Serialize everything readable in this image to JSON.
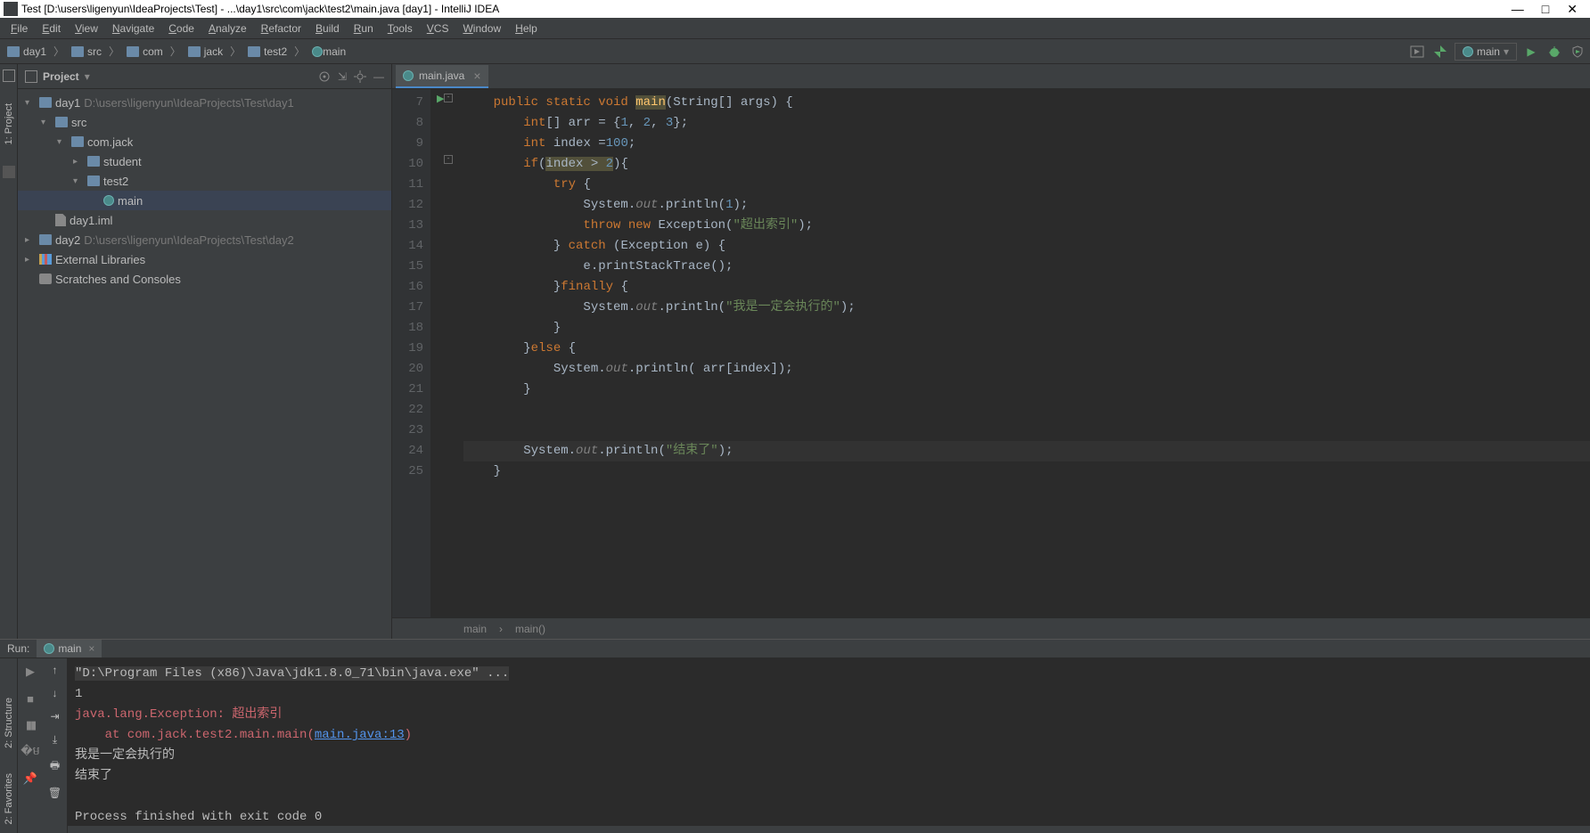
{
  "titlebar": {
    "text": "Test [D:\\users\\ligenyun\\IdeaProjects\\Test] - ...\\day1\\src\\com\\jack\\test2\\main.java [day1] - IntelliJ IDEA"
  },
  "menu": [
    "File",
    "Edit",
    "View",
    "Navigate",
    "Code",
    "Analyze",
    "Refactor",
    "Build",
    "Run",
    "Tools",
    "VCS",
    "Window",
    "Help"
  ],
  "breadcrumbs": [
    {
      "name": "day1",
      "icon": "module"
    },
    {
      "name": "src",
      "icon": "folder"
    },
    {
      "name": "com",
      "icon": "folder"
    },
    {
      "name": "jack",
      "icon": "folder"
    },
    {
      "name": "test2",
      "icon": "folder"
    },
    {
      "name": "main",
      "icon": "class"
    }
  ],
  "run_config_selected": "main",
  "project_panel": {
    "title": "Project",
    "tree": [
      {
        "depth": 0,
        "arrow": "down",
        "icon": "module",
        "label": "day1",
        "hint": "D:\\users\\ligenyun\\IdeaProjects\\Test\\day1"
      },
      {
        "depth": 1,
        "arrow": "down",
        "icon": "folder",
        "label": "src"
      },
      {
        "depth": 2,
        "arrow": "down",
        "icon": "folder",
        "label": "com.jack"
      },
      {
        "depth": 3,
        "arrow": "right",
        "icon": "folder",
        "label": "student"
      },
      {
        "depth": 3,
        "arrow": "down",
        "icon": "folder",
        "label": "test2"
      },
      {
        "depth": 4,
        "arrow": "",
        "icon": "class",
        "label": "main",
        "selected": true
      },
      {
        "depth": 1,
        "arrow": "",
        "icon": "file",
        "label": "day1.iml"
      },
      {
        "depth": 0,
        "arrow": "right",
        "icon": "module",
        "label": "day2",
        "hint": "D:\\users\\ligenyun\\IdeaProjects\\Test\\day2"
      },
      {
        "depth": 0,
        "arrow": "right",
        "icon": "lib",
        "label": "External Libraries"
      },
      {
        "depth": 0,
        "arrow": "",
        "icon": "scratch",
        "label": "Scratches and Consoles"
      }
    ]
  },
  "editor": {
    "tab_label": "main.java",
    "line_start": 7,
    "line_end": 25,
    "code_lines": [
      {
        "n": 7,
        "html": "    <span class='kw'>public static void</span> <span class='fn warn-bg'>main</span><span class='pln'>(String[] args) {</span>"
      },
      {
        "n": 8,
        "html": "        <span class='kw'>int</span><span class='pln'>[] arr = {</span><span class='num'>1</span><span class='pln'>, </span><span class='num'>2</span><span class='pln'>, </span><span class='num'>3</span><span class='pln'>};</span>"
      },
      {
        "n": 9,
        "html": "        <span class='kw'>int</span><span class='pln'> index =</span><span class='num'>100</span><span class='pln'>;</span>"
      },
      {
        "n": 10,
        "html": "        <span class='kw'>if</span><span class='pln'>(</span><span class='warn-bg'><span class='pln'>index &gt; </span><span class='num'>2</span></span><span class='pln'>){</span>"
      },
      {
        "n": 11,
        "html": "            <span class='kw'>try</span><span class='pln'> {</span>"
      },
      {
        "n": 12,
        "html": "                <span class='pln'>System.</span><span class='it'>out</span><span class='pln'>.println(</span><span class='num'>1</span><span class='pln'>);</span>"
      },
      {
        "n": 13,
        "html": "                <span class='kw'>throw new</span><span class='pln'> Exception(</span><span class='str'>\"超出索引\"</span><span class='pln'>);</span>"
      },
      {
        "n": 14,
        "html": "            <span class='pln'>} </span><span class='kw'>catch</span><span class='pln'> (Exception e) {</span>"
      },
      {
        "n": 15,
        "html": "                <span class='pln'>e.printStackTrace();</span>"
      },
      {
        "n": 16,
        "html": "            <span class='pln'>}</span><span class='kw'>finally</span><span class='pln'> {</span>"
      },
      {
        "n": 17,
        "html": "                <span class='pln'>System.</span><span class='it'>out</span><span class='pln'>.println(</span><span class='str'>\"我是一定会执行的\"</span><span class='pln'>);</span>"
      },
      {
        "n": 18,
        "html": "            <span class='pln'>}</span>"
      },
      {
        "n": 19,
        "html": "        <span class='pln'>}</span><span class='kw'>else</span><span class='pln'> {</span>"
      },
      {
        "n": 20,
        "html": "            <span class='pln'>System.</span><span class='it'>out</span><span class='pln'>.println( arr[index]);</span>"
      },
      {
        "n": 21,
        "html": "        <span class='pln'>}</span>"
      },
      {
        "n": 22,
        "html": ""
      },
      {
        "n": 23,
        "html": ""
      },
      {
        "n": 24,
        "caret": true,
        "html": "        <span class='pln'>System.</span><span class='it'>out</span><span class='pln'>.println(</span><span class='str'>\"结束了\"</span><span class='pln'>);</span>"
      },
      {
        "n": 25,
        "html": "    <span class='pln'>}</span>"
      }
    ],
    "breadcrumb_items": [
      "main",
      "main()"
    ]
  },
  "run_tool": {
    "header_label": "Run:",
    "tab_label": "main",
    "console_lines": [
      {
        "html": "<span class='cmd'>\"D:\\Program Files (x86)\\Java\\jdk1.8.0_71\\bin\\java.exe\" ...</span>"
      },
      {
        "html": "1"
      },
      {
        "html": "<span class='err'>java.lang.Exception: 超出索引</span>"
      },
      {
        "html": "<span class='err'>    at com.jack.test2.main.main(</span><span class='link'>main.java:13</span><span class='err'>)</span>"
      },
      {
        "html": "我是一定会执行的"
      },
      {
        "html": "结束了"
      },
      {
        "html": ""
      },
      {
        "html": "Process finished with exit code 0"
      }
    ]
  },
  "side_tabs": {
    "left_top": "1: Project",
    "left_bottom": [
      "2: Structure",
      "2: Favorites"
    ]
  }
}
